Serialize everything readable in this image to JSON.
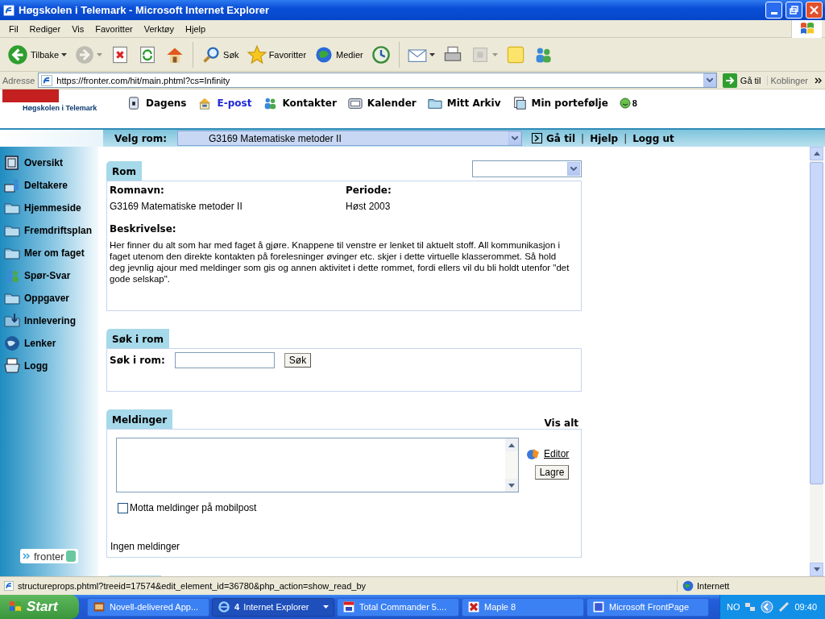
{
  "window": {
    "title": "Høgskolen i Telemark - Microsoft Internet Explorer"
  },
  "menu": [
    "Fil",
    "Rediger",
    "Vis",
    "Favoritter",
    "Verktøy",
    "Hjelp"
  ],
  "toolbar": [
    {
      "kind": "back",
      "label": "Tilbake",
      "caret": true,
      "disabled": false
    },
    {
      "kind": "forward",
      "caret": true,
      "disabled": true
    },
    {
      "kind": "stop",
      "disabled": false
    },
    {
      "kind": "refresh",
      "disabled": false
    },
    {
      "kind": "home",
      "disabled": false
    },
    {
      "kind": "sep"
    },
    {
      "kind": "search",
      "label": "Søk",
      "disabled": false
    },
    {
      "kind": "star",
      "label": "Favoritter",
      "disabled": false
    },
    {
      "kind": "media",
      "label": "Medier",
      "disabled": false
    },
    {
      "kind": "history",
      "disabled": false
    },
    {
      "kind": "sep"
    },
    {
      "kind": "mail",
      "caret": true,
      "disabled": false
    },
    {
      "kind": "print",
      "disabled": false
    },
    {
      "kind": "edit",
      "caret": true,
      "disabled": true
    },
    {
      "kind": "note",
      "disabled": false
    },
    {
      "kind": "people",
      "disabled": false
    }
  ],
  "address": {
    "label": "Adresse",
    "url": "https://fronter.com/hit/main.phtml?cs=Infinity",
    "go": "Gå til",
    "links": "Koblinger"
  },
  "header": {
    "school": "Høgskolen i Telemark",
    "nav": [
      {
        "kind": "day",
        "label": "Dagens",
        "selected": false
      },
      {
        "kind": "house",
        "label": "E-post",
        "selected": true
      },
      {
        "kind": "people",
        "label": "Kontakter",
        "selected": false
      },
      {
        "kind": "calendar",
        "label": "Kalender",
        "selected": false
      },
      {
        "kind": "folder",
        "label": "Mitt Arkiv",
        "selected": false
      },
      {
        "kind": "portfolio",
        "label": "Min portefølje",
        "selected": false
      }
    ],
    "online_count": "8"
  },
  "room_bar": {
    "label": "Velg rom:",
    "room": "G3169 Matematiske metoder II",
    "items": [
      {
        "kind": "link",
        "label": "Gå til"
      },
      {
        "kind": "separator",
        "label": "|"
      },
      {
        "kind": "link",
        "label": "Hjelp"
      },
      {
        "kind": "separator",
        "label": "|"
      },
      {
        "kind": "link",
        "label": "Logg ut"
      }
    ]
  },
  "sidebar": {
    "items": [
      {
        "kind": "overview",
        "label": "Oversikt"
      },
      {
        "kind": "participants",
        "label": "Deltakere"
      },
      {
        "kind": "folder",
        "label": "Hjemmeside"
      },
      {
        "kind": "folder",
        "label": "Fremdriftsplan"
      },
      {
        "kind": "folder",
        "label": "Mer om faget"
      },
      {
        "kind": "people",
        "label": "Spør-Svar"
      },
      {
        "kind": "folder",
        "label": "Oppgaver"
      },
      {
        "kind": "inbox",
        "label": "Innlevering"
      },
      {
        "kind": "globe",
        "label": "Lenker"
      },
      {
        "kind": "log",
        "label": "Logg"
      }
    ],
    "logo": "fronter"
  },
  "room_panel": {
    "tab": "Rom",
    "fields": [
      {
        "label": "Romnavn:",
        "value": "G3169 Matematiske metoder II"
      },
      {
        "label": "Periode:",
        "value": "Høst 2003"
      }
    ],
    "description_label": "Beskrivelse:",
    "description": "Her finner du alt som har med faget å gjøre. Knappene til venstre er lenket til aktuelt stoff. All kommunikasjon i faget utenom den direkte kontakten på forelesninger øvinger etc. skjer i dette virtuelle klasserommet. Så hold deg jevnlig ajour med meldinger som gis og annen aktivitet i dette rommet, fordi ellers vil du bli holdt utenfor \"det gode selskap\"."
  },
  "search_panel": {
    "tab": "Søk i rom",
    "label": "Søk i rom:",
    "button": "Søk"
  },
  "messages_panel": {
    "tab": "Meldinger",
    "show_all": "Vis alt",
    "editor": "Editor",
    "save": "Lagre",
    "mobile": {
      "label": "Motta meldinger på mobilpost",
      "checked": false
    },
    "empty": "Ingen meldinger"
  },
  "status_bar": {
    "text": "structureprops.phtml?treeid=17574&edit_element_id=36780&php_action=show_read_by",
    "zone": "Internett"
  },
  "taskbar": {
    "start": "Start",
    "tasks": [
      {
        "label": "Novell-delivered App...",
        "selected": false
      },
      {
        "count": "4",
        "label": "Internet Explorer",
        "selected": true
      },
      {
        "label": "Total Commander 5....",
        "selected": false
      },
      {
        "label": "Maple 8",
        "selected": false
      },
      {
        "label": "Microsoft FrontPage",
        "selected": false
      }
    ],
    "language": "NO",
    "clock": "09:40"
  }
}
